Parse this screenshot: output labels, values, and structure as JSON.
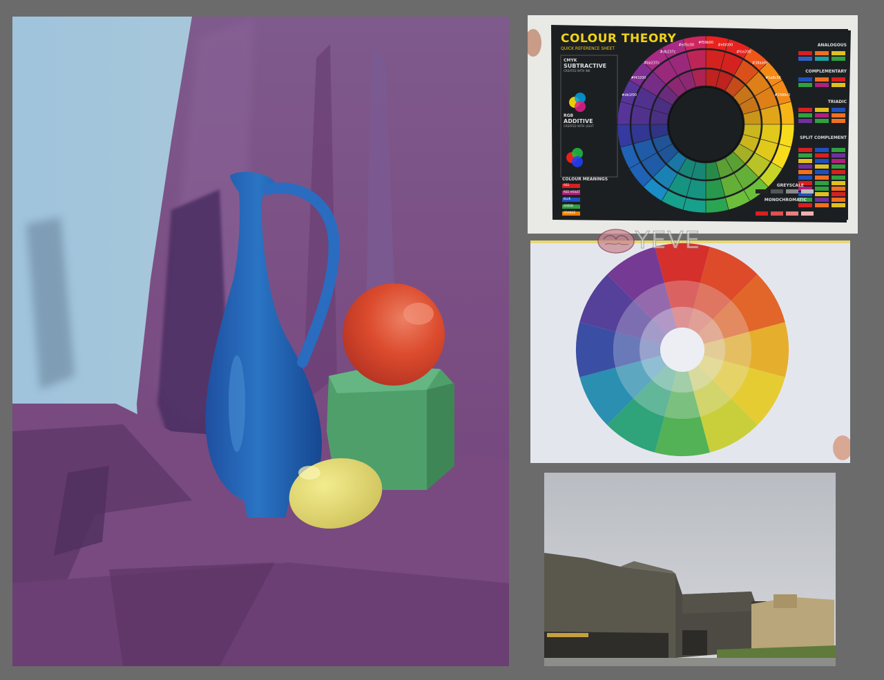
{
  "sheet": {
    "title": "COLOUR THEORY",
    "subtitle": "QUICK REFERENCE SHEET",
    "cmyk_label": "CMYK",
    "subtractive": "SUBTRACTIVE",
    "subtractive_note": "CREATED WITH INK",
    "rgb_label": "RGB",
    "additive": "ADDITIVE",
    "additive_note": "CREATED WITH LIGHT",
    "colour_meanings_heading": "COLOUR MEANINGS",
    "meanings": [
      "RED",
      "RED VIOLET",
      "BLUE",
      "GREEN",
      "ORANGE"
    ],
    "sections": {
      "analogous": "ANALOGOUS",
      "complementary": "COMPLEMENTARY",
      "triadic": "TRIADIC",
      "split_complement": "SPLIT COMPLEMENT",
      "greyscale": "GREYSCALE",
      "monochromatic": "MONOCHROMATIC"
    },
    "hex_labels": [
      "#db1f00",
      "#f43200",
      "#bb237c",
      "#db237c",
      "#e05c00",
      "#f59b00",
      "#efd000",
      "#fce200",
      "#38aa0e",
      "#1e8c56",
      "#1586c0"
    ]
  },
  "watermark": {
    "text": "YEVE",
    "logo_icon": "brain-logo-icon"
  },
  "colors": {
    "background": "#6b6b6b",
    "canvas_purple": "#7a4c80",
    "jug_blue": "#1e63b0",
    "orange": "#d9482c",
    "cube_green": "#4fa66c",
    "lemon": "#e2d96a",
    "sheet_dark": "#1c1f22",
    "title_yellow": "#f0d21a"
  }
}
